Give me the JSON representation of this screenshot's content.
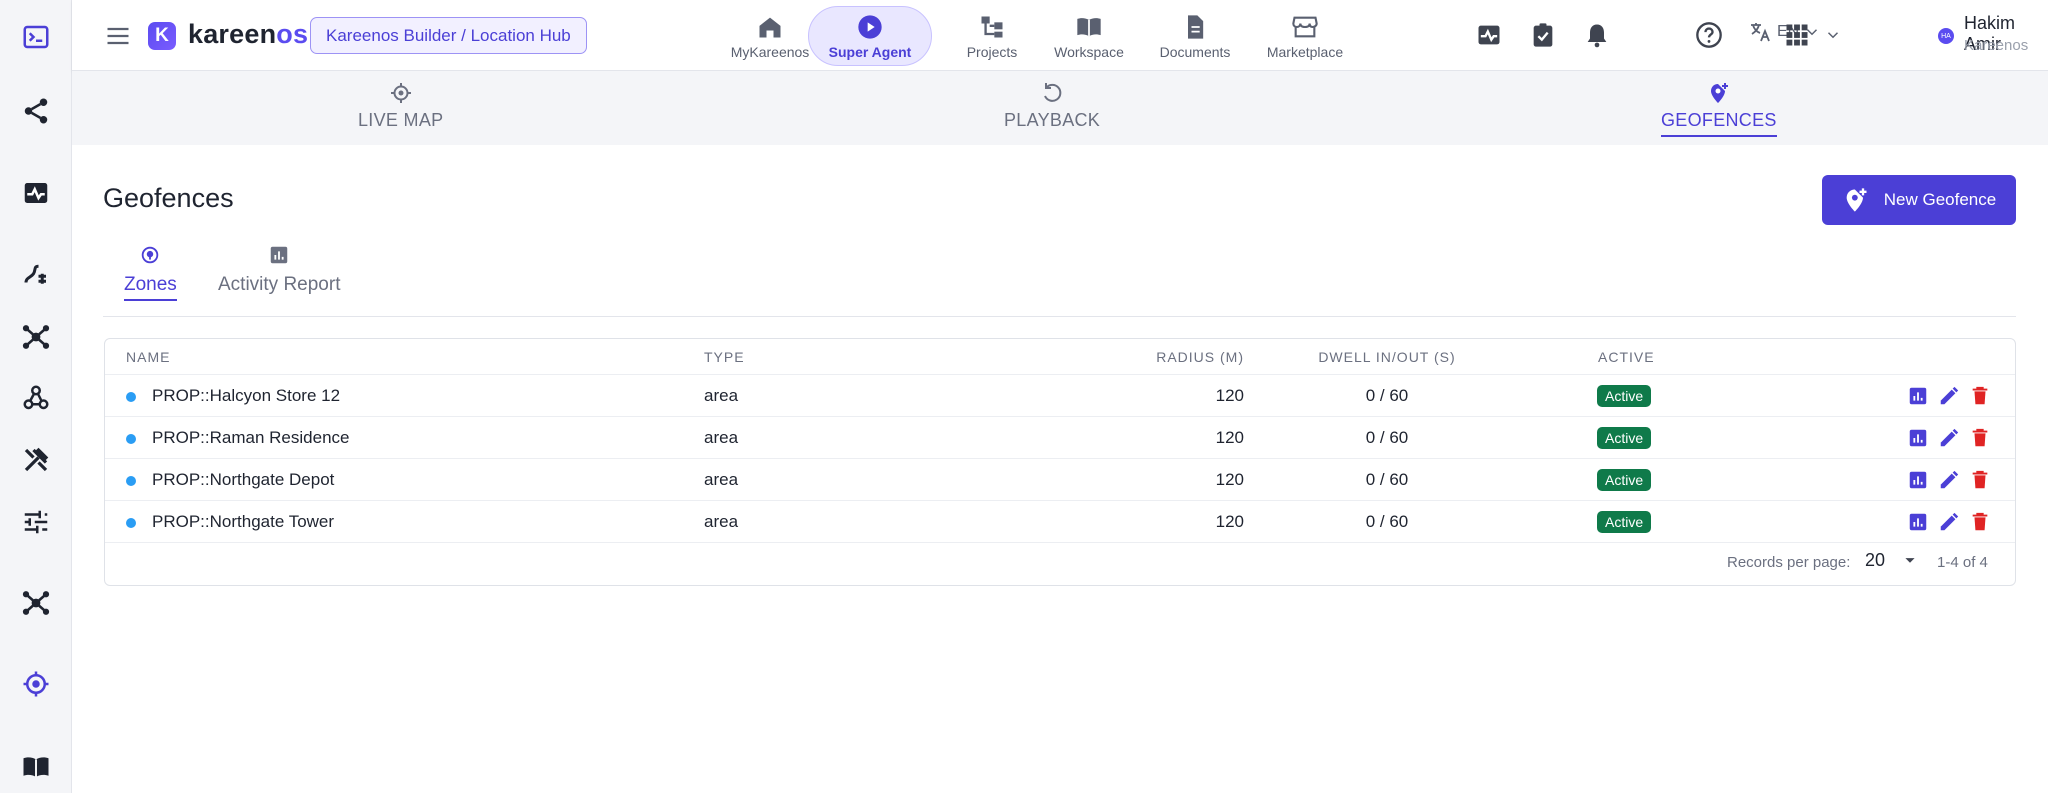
{
  "app": {
    "logo_text_a": "kareen",
    "logo_text_b": "os",
    "logo_mark": "K",
    "breadcrumb": "Kareenos Builder / Location Hub"
  },
  "nav": [
    {
      "label": "MyKareenos",
      "icon": "home-icon"
    },
    {
      "label": "Super Agent",
      "icon": "play-icon"
    },
    {
      "label": "Projects",
      "icon": "projects-icon"
    },
    {
      "label": "Workspace",
      "icon": "book-open-icon"
    },
    {
      "label": "Documents",
      "icon": "document-icon"
    },
    {
      "label": "Marketplace",
      "icon": "store-icon"
    }
  ],
  "header": {
    "language": "EN",
    "user_initials": "HA",
    "user_name": "Hakim Amir",
    "user_org": "Kareenos"
  },
  "subnav": {
    "live_map": "LIVE MAP",
    "playback": "PLAYBACK",
    "geofences": "GEOFENCES"
  },
  "page": {
    "title": "Geofences",
    "new_button": "New Geofence",
    "tabs": [
      "Zones",
      "Activity Report"
    ]
  },
  "table": {
    "headers": [
      "Name",
      "Type",
      "Radius (m)",
      "Dwell In/Out (s)",
      "Active"
    ],
    "rows": [
      {
        "name": "PROP::Halcyon Store 12",
        "type": "area",
        "radius": "120",
        "dwell": "0 / 60",
        "active": "Active"
      },
      {
        "name": "PROP::Raman Residence",
        "type": "area",
        "radius": "120",
        "dwell": "0 / 60",
        "active": "Active"
      },
      {
        "name": "PROP::Northgate Depot",
        "type": "area",
        "radius": "120",
        "dwell": "0 / 60",
        "active": "Active"
      },
      {
        "name": "PROP::Northgate Tower",
        "type": "area",
        "radius": "120",
        "dwell": "0 / 60",
        "active": "Active"
      }
    ],
    "pager_label": "Records per page:",
    "pager_value": "20",
    "pager_range": "1-4 of 4"
  },
  "colors": {
    "accent": "#4b3fd6",
    "badge": "#0f7a4a",
    "danger": "#e02424",
    "dot": "#2a9df4"
  }
}
